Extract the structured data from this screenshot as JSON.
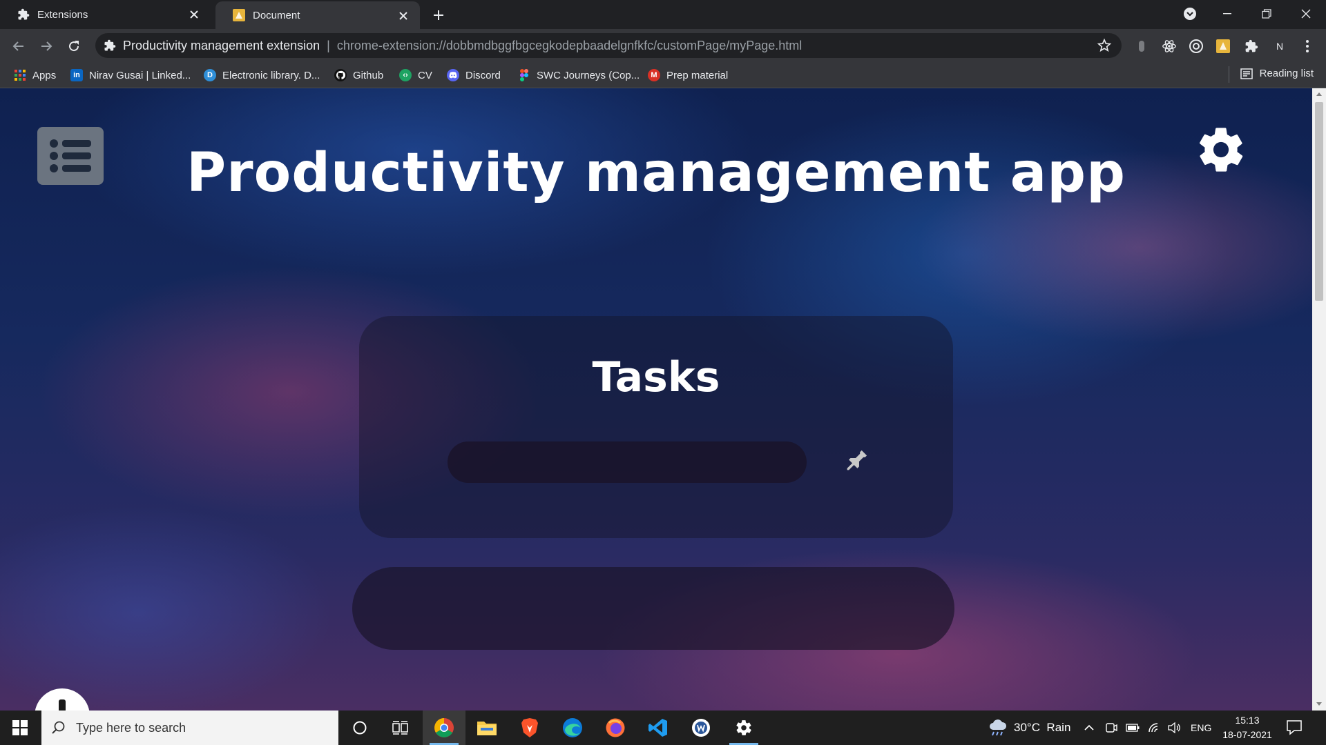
{
  "browser": {
    "tabs": [
      {
        "title": "Extensions",
        "active": false
      },
      {
        "title": "Document",
        "active": true
      }
    ],
    "omnibox": {
      "site_name": "Productivity management extension",
      "separator": "|",
      "url": "chrome-extension://dobbmdbggfbgcegkodepbaadelgnfkfc/customPage/myPage.html"
    },
    "profile_initial": "N",
    "bookmarks": [
      {
        "label": "Apps",
        "icon": "apps-grid-icon"
      },
      {
        "label": "Nirav Gusai | Linked...",
        "icon": "linkedin-icon"
      },
      {
        "label": "Electronic library. D...",
        "icon": "library-icon"
      },
      {
        "label": "Github",
        "icon": "github-icon"
      },
      {
        "label": "CV",
        "icon": "cv-icon"
      },
      {
        "label": "Discord",
        "icon": "discord-icon"
      },
      {
        "label": "SWC Journeys (Cop...",
        "icon": "figma-icon"
      },
      {
        "label": "Prep material",
        "icon": "gmail-icon"
      }
    ],
    "reading_list": "Reading list"
  },
  "app": {
    "title": "Productivity management app",
    "tasks_heading": "Tasks",
    "task_input_value": "",
    "colors": {
      "menu_button": "#6b7480",
      "card_bg": "rgba(20,20,40,0.45)",
      "text": "#ffffff"
    }
  },
  "taskbar": {
    "search_placeholder": "Type here to search",
    "weather": "30°C  Rain",
    "language": "ENG",
    "time": "15:13",
    "date": "18-07-2021"
  }
}
